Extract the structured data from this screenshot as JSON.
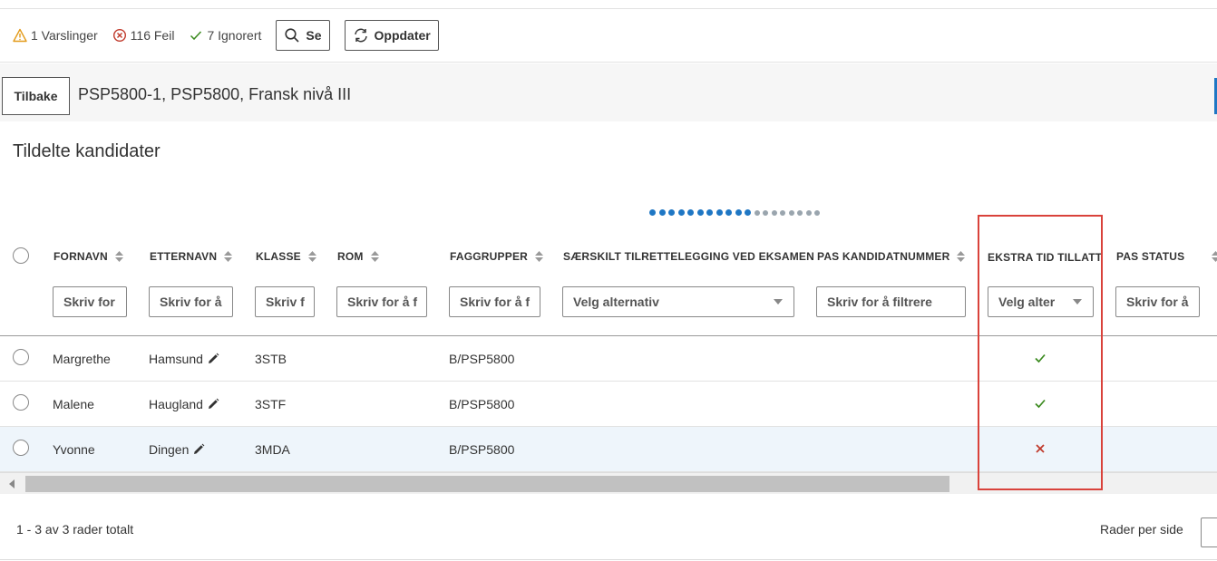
{
  "status": {
    "warnings": "1 Varslinger",
    "errors": "116 Feil",
    "ignored": "7 Ignorert",
    "see_label": "Se",
    "refresh_label": "Oppdater"
  },
  "header": {
    "back_label": "Tilbake",
    "title": "PSP5800-1, PSP5800, Fransk nivå III"
  },
  "section": {
    "title": "Tildelte kandidater"
  },
  "pagination_dots": {
    "total": 19,
    "active": 11,
    "active_color": "#1f77c4",
    "inactive_color": "#9aa5ae"
  },
  "table": {
    "columns": [
      {
        "key": "fornavn",
        "label": "FORNAVN",
        "filter": "Skriv for",
        "filter_type": "text"
      },
      {
        "key": "etternavn",
        "label": "ETTERNAVN",
        "filter": "Skriv for å",
        "filter_type": "text"
      },
      {
        "key": "klasse",
        "label": "KLASSE",
        "filter": "Skriv f",
        "filter_type": "text"
      },
      {
        "key": "rom",
        "label": "ROM",
        "filter": "Skriv for å f",
        "filter_type": "text"
      },
      {
        "key": "faggrupper",
        "label": "FAGGRUPPER",
        "filter": "Skriv for å f",
        "filter_type": "text"
      },
      {
        "key": "saerskilt",
        "label": "SÆRSKILT TILRETTELEGGING VED EKSAMEN",
        "filter": "Velg alternativ",
        "filter_type": "select"
      },
      {
        "key": "pas_kandidatnummer",
        "label": "PAS KANDIDATNUMMER",
        "filter": "Skriv for å filtrere",
        "filter_type": "text"
      },
      {
        "key": "ekstra_tid",
        "label": "EKSTRA TID TILLATT",
        "filter": "Velg alter",
        "filter_type": "select"
      },
      {
        "key": "pas_status",
        "label": "PAS STATUS",
        "filter": "Skriv for å",
        "filter_type": "text"
      }
    ],
    "rows": [
      {
        "fornavn": "Margrethe",
        "etternavn": "Hamsund",
        "klasse": "3STB",
        "rom": "",
        "faggrupper": "B/PSP5800",
        "ekstra_tid": "yes"
      },
      {
        "fornavn": "Malene",
        "etternavn": "Haugland",
        "klasse": "3STF",
        "rom": "",
        "faggrupper": "B/PSP5800",
        "ekstra_tid": "yes"
      },
      {
        "fornavn": "Yvonne",
        "etternavn": "Dingen",
        "klasse": "3MDA",
        "rom": "",
        "faggrupper": "B/PSP5800",
        "ekstra_tid": "no"
      }
    ]
  },
  "footer": {
    "total_label": "1 - 3 av 3 rader totalt",
    "per_page_label": "Rader per side"
  },
  "colors": {
    "check": "#3b8a1f",
    "cross": "#c0392b",
    "highlight": "#d9423b",
    "selected_row": "#eef5fb"
  }
}
